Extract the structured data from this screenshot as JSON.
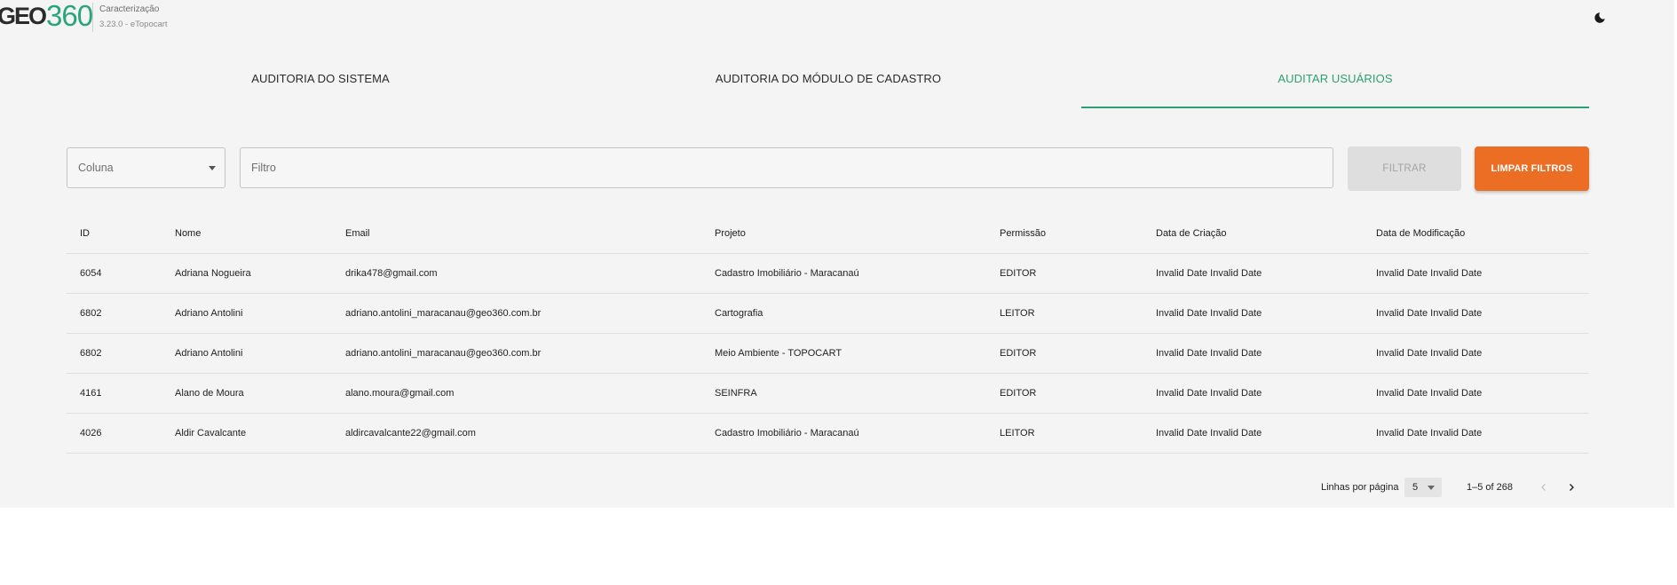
{
  "header": {
    "logo_text_left": "GEO",
    "logo_text_right": "360",
    "app_name": "Caracterização",
    "app_version": "3.23.0 - eTopocart",
    "theme_icon": "moon-icon"
  },
  "tabs": [
    {
      "label": "AUDITORIA DO SISTEMA",
      "active": false
    },
    {
      "label": "AUDITORIA DO MÓDULO DE CADASTRO",
      "active": false
    },
    {
      "label": "AUDITAR USUÁRIOS",
      "active": true
    }
  ],
  "filters": {
    "column_label": "Coluna",
    "filter_placeholder": "Filtro",
    "filter_value": "",
    "filter_button": "FILTRAR",
    "clear_button": "LIMPAR FILTROS"
  },
  "table": {
    "columns": [
      "ID",
      "Nome",
      "Email",
      "Projeto",
      "Permissão",
      "Data de Criação",
      "Data de Modificação"
    ],
    "rows": [
      [
        "6054",
        "Adriana Nogueira",
        "drika478@gmail.com",
        "Cadastro Imobiliário - Maracanaú",
        "EDITOR",
        "Invalid Date Invalid Date",
        "Invalid Date Invalid Date"
      ],
      [
        "6802",
        "Adriano Antolini",
        "adriano.antolini_maracanau@geo360.com.br",
        "Cartografia",
        "LEITOR",
        "Invalid Date Invalid Date",
        "Invalid Date Invalid Date"
      ],
      [
        "6802",
        "Adriano Antolini",
        "adriano.antolini_maracanau@geo360.com.br",
        "Meio Ambiente - TOPOCART",
        "EDITOR",
        "Invalid Date Invalid Date",
        "Invalid Date Invalid Date"
      ],
      [
        "4161",
        "Alano de Moura",
        "alano.moura@gmail.com",
        "SEINFRA",
        "EDITOR",
        "Invalid Date Invalid Date",
        "Invalid Date Invalid Date"
      ],
      [
        "4026",
        "Aldir Cavalcante",
        "aldircavalcante22@gmail.com",
        "Cadastro Imobiliário - Maracanaú",
        "LEITOR",
        "Invalid Date Invalid Date",
        "Invalid Date Invalid Date"
      ]
    ]
  },
  "pagination": {
    "rows_per_page_label": "Linhas por página",
    "rows_per_page": "5",
    "range": "1–5 of 268",
    "prev_icon": "chevron-left-icon",
    "next_icon": "chevron-right-icon"
  },
  "colors": {
    "brand_green": "#2d9f73",
    "accent_orange": "#ec6d24",
    "background": "#f4f4f4"
  }
}
